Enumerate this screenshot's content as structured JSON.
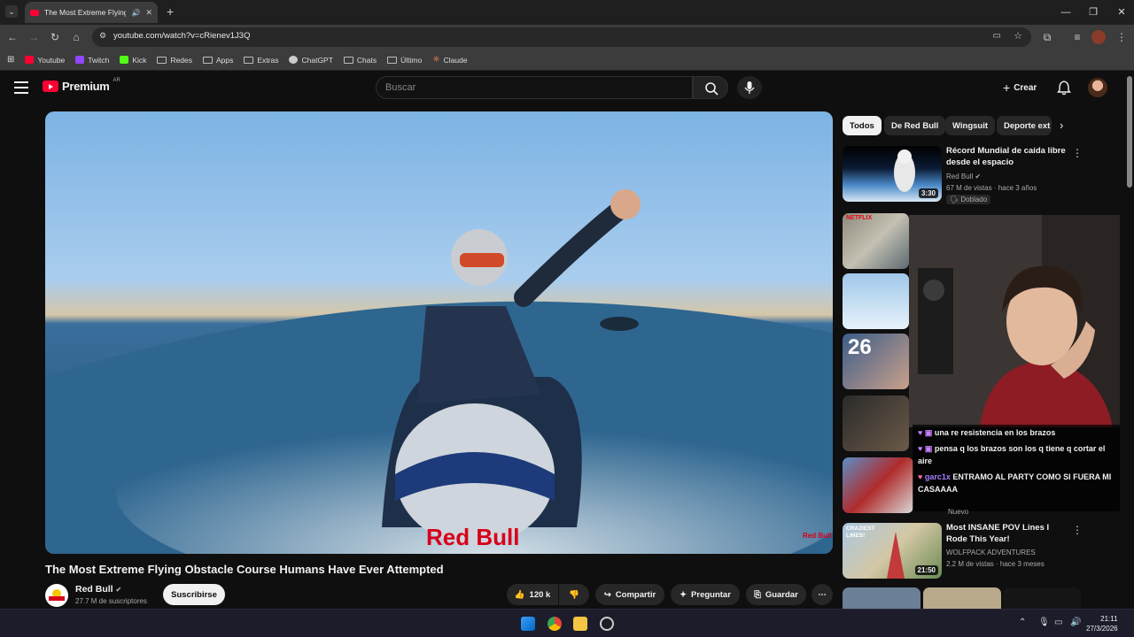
{
  "browser": {
    "tab_title": "The Most Extreme Flying O",
    "url": "youtube.com/watch?v=cRienev1J3Q",
    "bookmarks": [
      {
        "label": "Youtube",
        "icon": "youtube-icon",
        "color": "#ff0033"
      },
      {
        "label": "Twitch",
        "icon": "twitch-icon",
        "color": "#9146ff"
      },
      {
        "label": "Kick",
        "icon": "kick-icon",
        "color": "#53fc18"
      },
      {
        "label": "Redes",
        "icon": "folder-icon"
      },
      {
        "label": "Apps",
        "icon": "folder-icon"
      },
      {
        "label": "Extras",
        "icon": "folder-icon"
      },
      {
        "label": "ChatGPT",
        "icon": "chatgpt-icon"
      },
      {
        "label": "Chats",
        "icon": "folder-icon"
      },
      {
        "label": "Último",
        "icon": "folder-icon"
      },
      {
        "label": "Claude",
        "icon": "claude-icon",
        "color": "#d97757"
      }
    ]
  },
  "header": {
    "logo_text": "Premium",
    "country": "AR",
    "search_placeholder": "Buscar",
    "create_label": "Crear"
  },
  "video": {
    "title": "The Most Extreme Flying Obstacle Course Humans Have Ever Attempted",
    "channel": "Red Bull",
    "subscribers": "27.7 M de suscriptores",
    "subscribe_label": "Suscribirse",
    "likes": "120 k",
    "share_label": "Compartir",
    "ask_label": "Preguntar",
    "save_label": "Guardar"
  },
  "chips": [
    "Todos",
    "De Red Bull",
    "Wingsuit",
    "Deporte ext"
  ],
  "recommendations": [
    {
      "title": "Récord Mundial de caída libre desde el espacio",
      "channel": "Red Bull",
      "meta": "67 M de vistas · hace 3 años",
      "badge": "Doblado",
      "duration": "3:30"
    },
    {
      "title": "Most INSANE POV Lines I Rode This Year!",
      "channel": "WOLFPACK ADVENTURES",
      "meta": "2.2 M de vistas · hace 3 meses",
      "duration": "21:50"
    }
  ],
  "thumb_text": {
    "netflix": "NETFLIX",
    "crazy": "CRAZIEST LINES!",
    "number": "26"
  },
  "chat": [
    {
      "user": "",
      "message": "una re resistencia en los brazos"
    },
    {
      "user": "",
      "message": "pensa q los brazos son los q tiene q cortar el aire"
    },
    {
      "user": "garc1x",
      "message": "ENTRAMO AL PARTY COMO SI FUERA MI CASAAAA"
    }
  ],
  "under_chat_label": "Nuevo",
  "taskbar": {
    "time": "21:11",
    "date": "27/3/2026"
  },
  "colors": {
    "youtube_red": "#ff0033",
    "background": "#0f0f0f"
  }
}
